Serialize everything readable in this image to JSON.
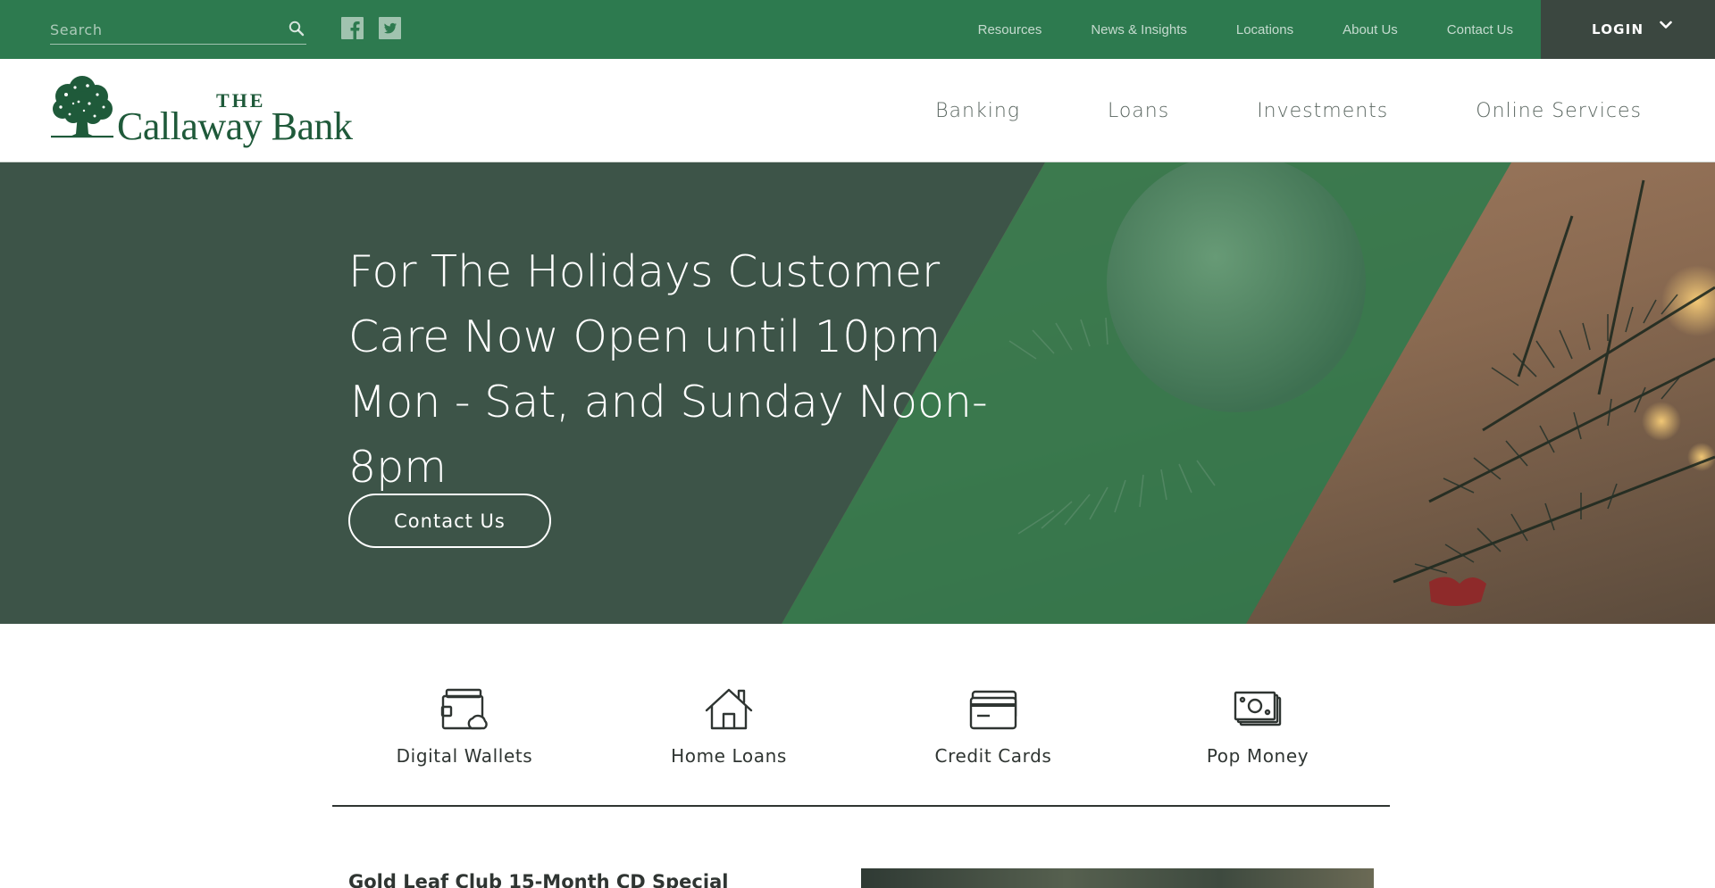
{
  "topbar": {
    "search": {
      "placeholder": "Search",
      "value": ""
    },
    "social": [
      "facebook-icon",
      "twitter-icon"
    ],
    "links": [
      "Resources",
      "News & Insights",
      "Locations",
      "About Us",
      "Contact Us"
    ],
    "login_label": "LOGIN",
    "colors": {
      "bar": "#2d7a4f",
      "login": "#3b4740"
    }
  },
  "header": {
    "logo": {
      "the": "THE",
      "name": "Callaway Bank"
    },
    "nav": [
      "Banking",
      "Loans",
      "Investments",
      "Online Services"
    ]
  },
  "hero": {
    "headline": "For The Holidays Customer Care Now Open until 10pm Mon - Sat, and Sunday Noon-8pm",
    "button_label": "Contact Us"
  },
  "quick_links": [
    {
      "label": "Digital Wallets",
      "icon": "digital-wallet-icon"
    },
    {
      "label": "Home Loans",
      "icon": "house-icon"
    },
    {
      "label": "Credit Cards",
      "icon": "credit-card-icon"
    },
    {
      "label": "Pop Money",
      "icon": "money-icon"
    }
  ],
  "teaser": {
    "title": "Gold Leaf Club 15-Month CD Special"
  }
}
